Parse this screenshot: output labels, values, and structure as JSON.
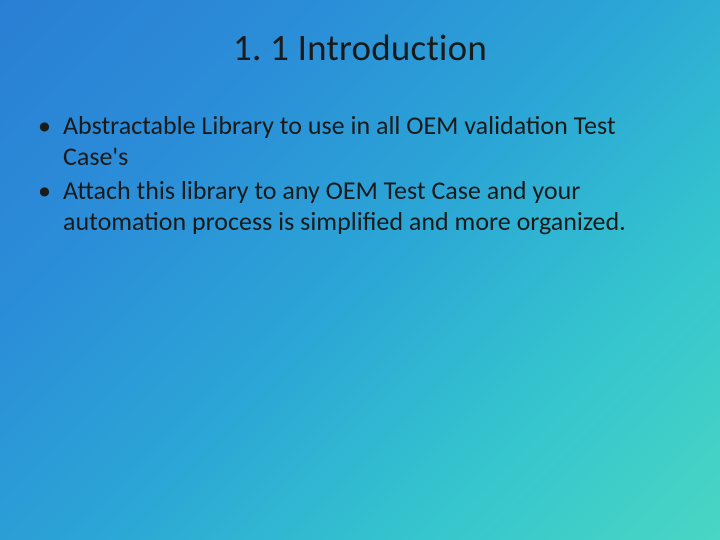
{
  "slide": {
    "title": "1. 1 Introduction",
    "bullets": [
      "Abstractable Library to use in all OEM validation Test Case's",
      "Attach this library to any OEM Test Case and your automation process is simplified and more organized."
    ]
  }
}
